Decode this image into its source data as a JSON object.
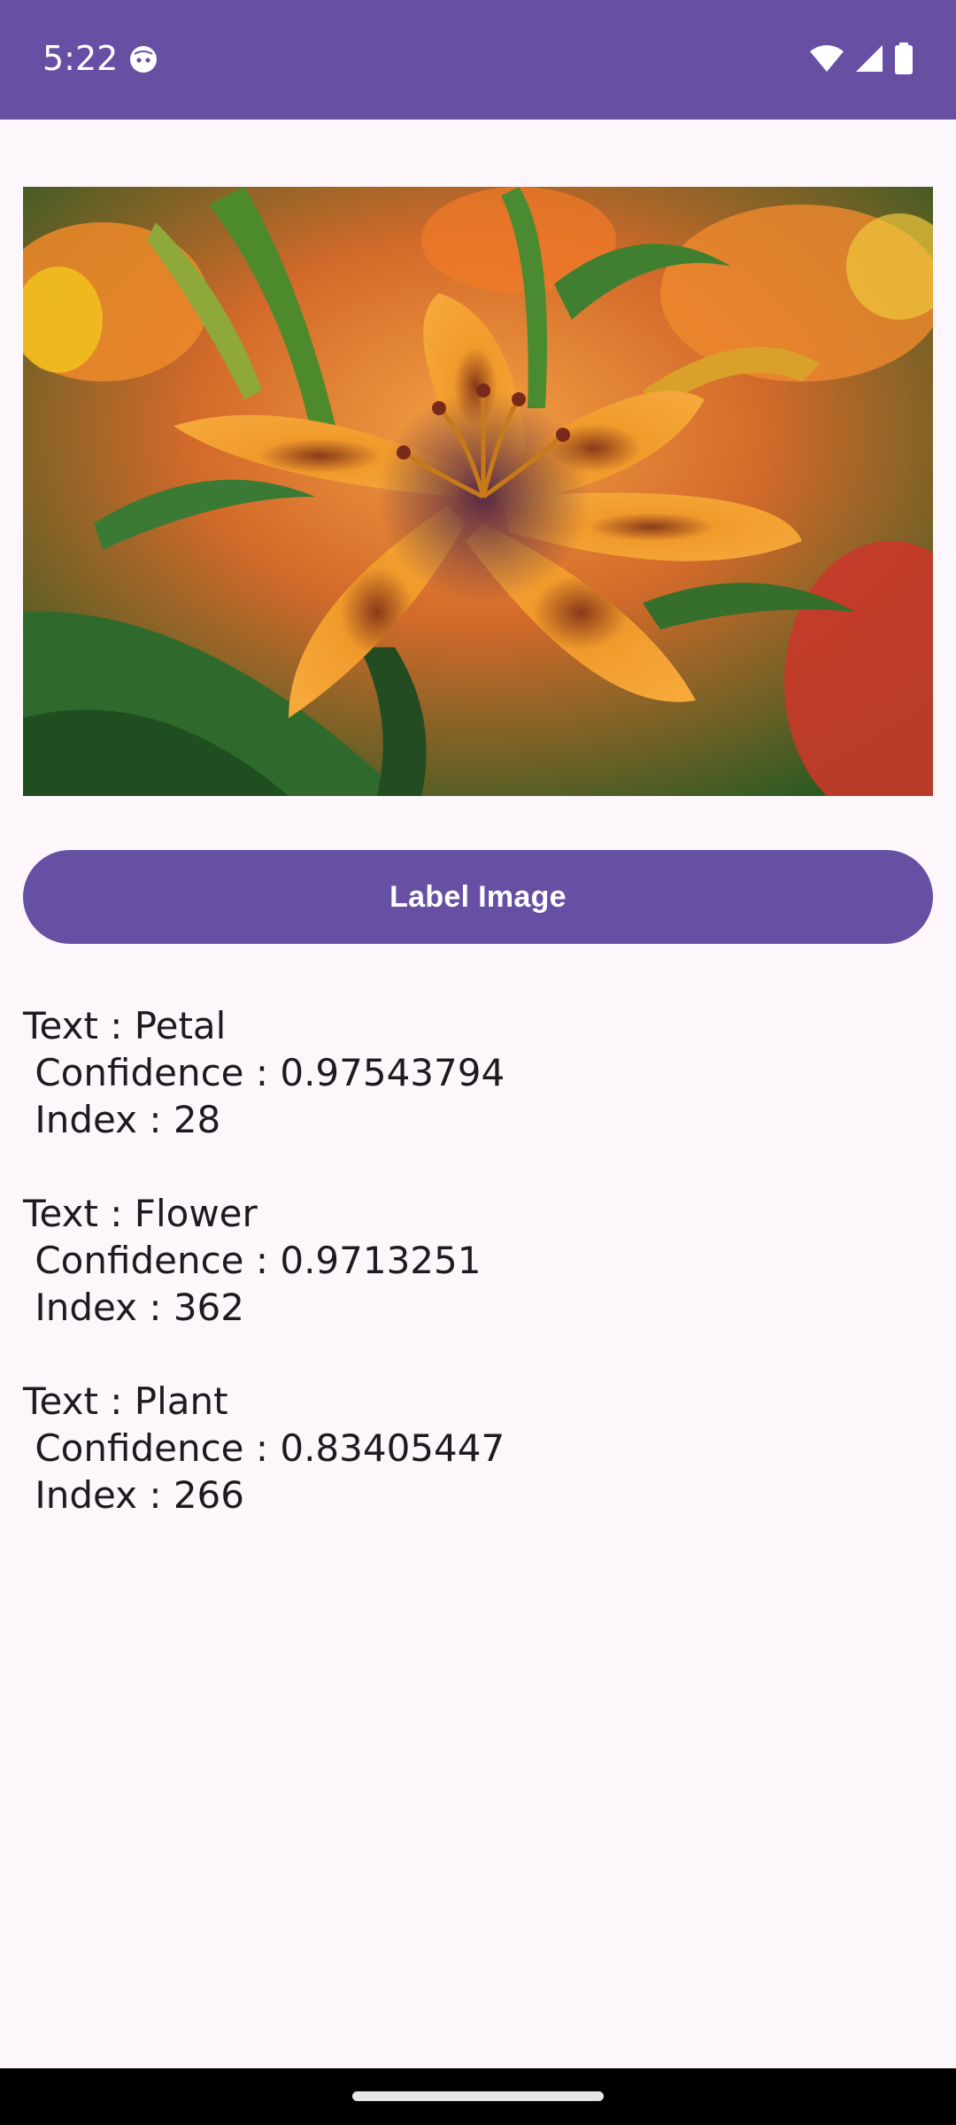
{
  "status_bar": {
    "time": "5:22",
    "icons": [
      "android-face-icon",
      "wifi-icon",
      "cellular-signal-icon",
      "battery-icon"
    ]
  },
  "image": {
    "subject_icon": "lily-flower-photo"
  },
  "button": {
    "label": "Label Image"
  },
  "results": [
    {
      "text_line": "Text : Petal",
      "confidence_line": " Confidence : 0.97543794",
      "index_line": " Index : 28"
    },
    {
      "text_line": "Text : Flower",
      "confidence_line": " Confidence : 0.9713251",
      "index_line": " Index : 362"
    },
    {
      "text_line": "Text : Plant",
      "confidence_line": " Confidence : 0.83405447",
      "index_line": " Index : 266"
    }
  ],
  "colors": {
    "primary": "#6750a4",
    "background": "#fdf7fc",
    "text": "#1d1b20"
  }
}
